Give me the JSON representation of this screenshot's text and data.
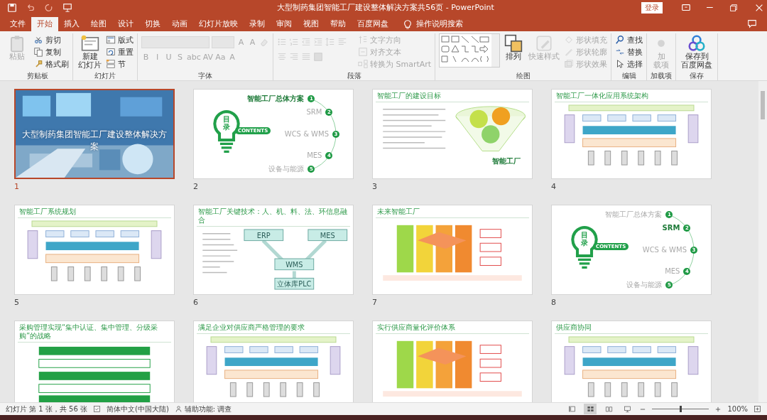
{
  "window": {
    "title": "大型制药集团智能工厂建设整体解决方案共56页 - PowerPoint",
    "login": "登录"
  },
  "tabs": [
    {
      "label": "文件",
      "selected": false
    },
    {
      "label": "开始",
      "selected": true
    },
    {
      "label": "插入",
      "selected": false
    },
    {
      "label": "绘图",
      "selected": false
    },
    {
      "label": "设计",
      "selected": false
    },
    {
      "label": "切换",
      "selected": false
    },
    {
      "label": "动画",
      "selected": false
    },
    {
      "label": "幻灯片放映",
      "selected": false
    },
    {
      "label": "录制",
      "selected": false
    },
    {
      "label": "审阅",
      "selected": false
    },
    {
      "label": "视图",
      "selected": false
    },
    {
      "label": "帮助",
      "selected": false
    },
    {
      "label": "百度网盘",
      "selected": false
    }
  ],
  "search": {
    "label": "操作说明搜索"
  },
  "ribbon": [
    {
      "label": "剪贴板",
      "items": [
        {
          "kind": "large",
          "lines": [
            "粘贴"
          ],
          "disabled": true
        },
        {
          "kind": "small",
          "label": "剪切",
          "disabled": false
        },
        {
          "kind": "small",
          "label": "复制",
          "disabled": false
        },
        {
          "kind": "small",
          "label": "格式刷",
          "disabled": false
        }
      ]
    },
    {
      "label": "幻灯片",
      "items": [
        {
          "kind": "large",
          "lines": [
            "新建",
            "幻灯片"
          ],
          "disabled": false
        },
        {
          "kind": "small",
          "label": "版式",
          "disabled": false
        },
        {
          "kind": "small",
          "label": "重置",
          "disabled": false
        },
        {
          "kind": "small",
          "label": "节",
          "disabled": false
        }
      ]
    },
    {
      "label": "字体",
      "items": [
        {
          "kind": "combo",
          "disabled": true
        },
        {
          "kind": "combo",
          "disabled": true
        },
        {
          "kind": "glyph",
          "label": "A",
          "disabled": true
        },
        {
          "kind": "glyph",
          "label": "A",
          "disabled": true
        },
        {
          "kind": "icon",
          "disabled": true
        },
        {
          "kind": "glyph",
          "label": "B",
          "disabled": true
        },
        {
          "kind": "glyph",
          "label": "I",
          "disabled": true
        },
        {
          "kind": "glyph",
          "label": "U",
          "disabled": true
        },
        {
          "kind": "glyph",
          "label": "S",
          "disabled": true
        },
        {
          "kind": "glyph",
          "label": "abc",
          "disabled": true
        },
        {
          "kind": "glyph",
          "label": "AV",
          "disabled": true
        },
        {
          "kind": "glyph",
          "label": "Aa",
          "disabled": true
        },
        {
          "kind": "glyph",
          "label": "A",
          "disabled": true
        }
      ]
    },
    {
      "label": "段落",
      "items": [
        {
          "kind": "icon",
          "disabled": true
        },
        {
          "kind": "icon",
          "disabled": true
        },
        {
          "kind": "icon",
          "disabled": true
        },
        {
          "kind": "icon",
          "disabled": true
        },
        {
          "kind": "icon",
          "disabled": true
        },
        {
          "kind": "icon",
          "disabled": true
        },
        {
          "kind": "icon",
          "disabled": true
        },
        {
          "kind": "icon",
          "disabled": true
        },
        {
          "kind": "icon",
          "disabled": true
        },
        {
          "kind": "icon",
          "disabled": true
        },
        {
          "kind": "small",
          "label": "文字方向",
          "disabled": true
        },
        {
          "kind": "small",
          "label": "对齐文本",
          "disabled": true
        },
        {
          "kind": "small",
          "label": "转换为 SmartArt",
          "disabled": true
        }
      ]
    },
    {
      "label": "绘图",
      "items": [
        {
          "kind": "gallery",
          "disabled": false
        },
        {
          "kind": "large",
          "lines": [
            "排列"
          ],
          "disabled": false
        },
        {
          "kind": "large",
          "lines": [
            "快速样式"
          ],
          "disabled": true
        },
        {
          "kind": "small",
          "label": "形状填充",
          "disabled": true
        },
        {
          "kind": "small",
          "label": "形状轮廓",
          "disabled": true
        },
        {
          "kind": "small",
          "label": "形状效果",
          "disabled": true
        }
      ]
    },
    {
      "label": "编辑",
      "items": [
        {
          "kind": "small",
          "label": "查找",
          "disabled": false
        },
        {
          "kind": "small",
          "label": "替换",
          "disabled": false
        },
        {
          "kind": "small",
          "label": "选择",
          "disabled": false
        }
      ]
    },
    {
      "label": "加载项",
      "items": [
        {
          "kind": "large",
          "lines": [
            "加",
            "载项"
          ],
          "disabled": true
        }
      ]
    },
    {
      "label": "保存",
      "items": [
        {
          "kind": "large",
          "lines": [
            "保存到",
            "百度网盘"
          ],
          "disabled": false
        }
      ]
    }
  ],
  "slides": [
    {
      "number": "1",
      "kind": "cover",
      "selected": true,
      "title": "大型制药集团智能工厂建设整体解决方案"
    },
    {
      "number": "2",
      "kind": "contents",
      "selected": false,
      "badge": "目录",
      "badge_sub": "CONTENTS",
      "items": [
        {
          "number": "1",
          "label": "智能工厂总体方案",
          "current": true
        },
        {
          "number": "2",
          "label": "SRM",
          "current": false
        },
        {
          "number": "3",
          "label": "WCS & WMS",
          "current": false
        },
        {
          "number": "4",
          "label": "MES",
          "current": false
        },
        {
          "number": "5",
          "label": "设备与能源",
          "current": false
        }
      ]
    },
    {
      "number": "3",
      "kind": "text-diagram",
      "selected": false,
      "title": "智能工厂的建设目标",
      "caption": "智能工厂"
    },
    {
      "number": "4",
      "kind": "architecture",
      "selected": false,
      "title": "智能工厂一体化应用系统架构"
    },
    {
      "number": "5",
      "kind": "architecture",
      "selected": false,
      "title": "智能工厂系统规划"
    },
    {
      "number": "6",
      "kind": "network",
      "selected": false,
      "title": "智能工厂关键技术：人、机、料、法、环信息融合",
      "boxes": [
        "ERP",
        "MES",
        "WMS",
        "立体库PLC"
      ]
    },
    {
      "number": "7",
      "kind": "blocks",
      "selected": false,
      "title": "未来智能工厂"
    },
    {
      "number": "8",
      "kind": "contents",
      "selected": false,
      "badge": "目录",
      "badge_sub": "CONTENTS",
      "items": [
        {
          "number": "1",
          "label": "智能工厂总体方案",
          "current": false
        },
        {
          "number": "2",
          "label": "SRM",
          "current": true
        },
        {
          "number": "3",
          "label": "WCS & WMS",
          "current": false
        },
        {
          "number": "4",
          "label": "MES",
          "current": false
        },
        {
          "number": "5",
          "label": "设备与能源",
          "current": false
        }
      ]
    },
    {
      "kind": "bars",
      "selected": false,
      "title": "采购管理实现“集中认证、集中管理、分级采购”的战略"
    },
    {
      "kind": "architecture",
      "selected": false,
      "title": "满足企业对供应商严格管理的要求"
    },
    {
      "kind": "blocks",
      "selected": false,
      "title": "实行供应商量化评价体系"
    },
    {
      "kind": "architecture",
      "selected": false,
      "title": "供应商协同"
    }
  ],
  "status_bar": {
    "slide_info": "幻灯片 第 1 张，共 56 张",
    "language": "简体中文(中国大陆)",
    "accessibility": "辅助功能: 调查",
    "views": [
      {
        "selected": false
      },
      {
        "selected": true
      },
      {
        "selected": false
      },
      {
        "selected": false
      }
    ],
    "zoom": {
      "level": 0.5,
      "reading": "100%"
    }
  }
}
